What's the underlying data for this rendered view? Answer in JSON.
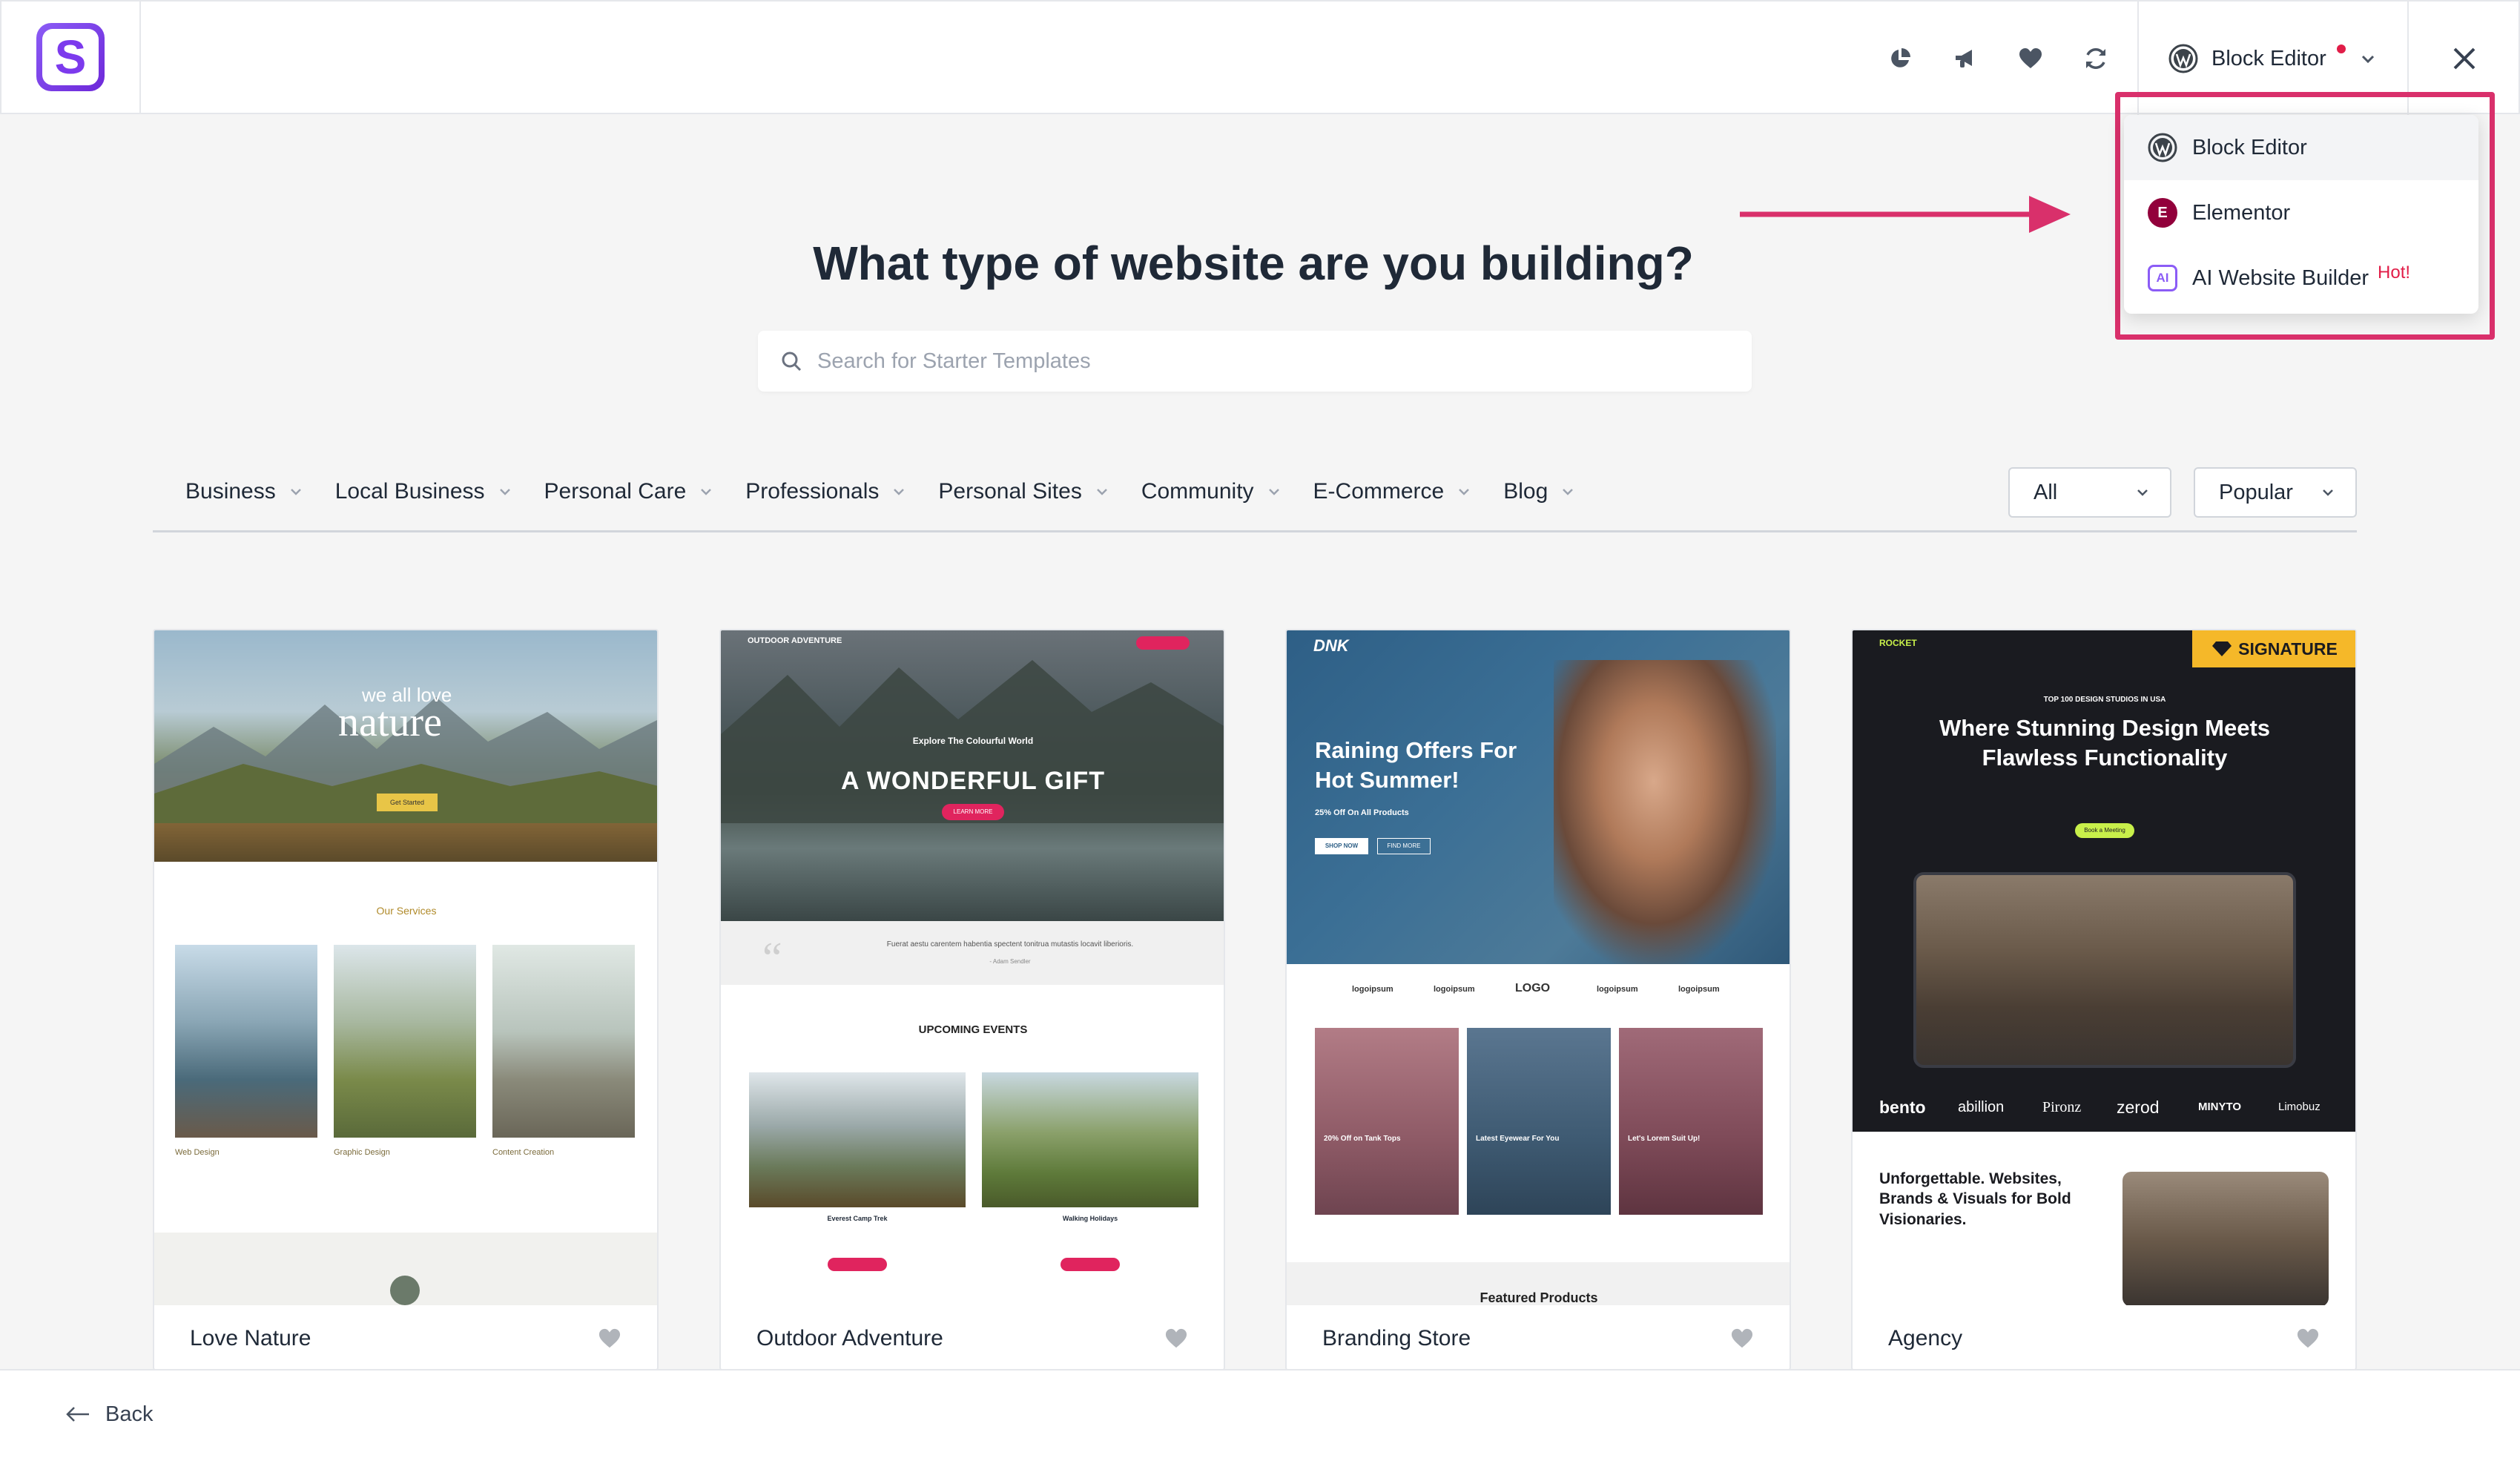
{
  "header": {
    "logo_letter": "S",
    "builder": {
      "label": "Block Editor"
    }
  },
  "dropdown": {
    "items": [
      {
        "label": "Block Editor",
        "icon": "wordpress-icon"
      },
      {
        "label": "Elementor",
        "icon": "elementor-icon",
        "icon_text": "E"
      },
      {
        "label": "AI Website Builder",
        "icon": "ai-icon",
        "icon_text": "AI",
        "badge": "Hot!"
      }
    ]
  },
  "main": {
    "heading": "What type of website are you building?",
    "search": {
      "placeholder": "Search for Starter Templates"
    }
  },
  "categories": [
    {
      "label": "Business"
    },
    {
      "label": "Local Business"
    },
    {
      "label": "Personal Care"
    },
    {
      "label": "Professionals"
    },
    {
      "label": "Personal Sites"
    },
    {
      "label": "Community"
    },
    {
      "label": "E-Commerce"
    },
    {
      "label": "Blog"
    }
  ],
  "filters": {
    "type": "All",
    "sort": "Popular"
  },
  "templates": [
    {
      "name": "Love Nature",
      "preview": {
        "hero_small": "we all love",
        "hero_big": "nature",
        "cta": "Get Started",
        "section": "Our Services",
        "services": [
          "Web Design",
          "Graphic Design",
          "Content Creation"
        ]
      }
    },
    {
      "name": "Outdoor Adventure",
      "preview": {
        "brand": "OUTDOOR ADVENTURE",
        "kicker": "Explore The Colourful World",
        "hero": "A WONDERFUL GIFT",
        "cta": "LEARN MORE",
        "quote": "Fuerat aestu carentem habentia spectent tonitrua mutastis locavit liberioris.",
        "quote_author": "- Adam Sendler",
        "section": "UPCOMING EVENTS",
        "events": [
          "Everest Camp Trek",
          "Walking Holidays"
        ]
      }
    },
    {
      "name": "Branding Store",
      "preview": {
        "brand": "DNK",
        "hero": "Raining Offers For Hot Summer!",
        "sub": "25% Off On All Products",
        "cta1": "SHOP NOW",
        "cta2": "FIND MORE",
        "logos": [
          "logoipsum",
          "logoipsum",
          "LOGO",
          "logoipsum",
          "logoipsum"
        ],
        "tiles": [
          "20% Off on Tank Tops",
          "Latest Eyewear For You",
          "Let's Lorem Suit Up!"
        ],
        "section": "Featured Products"
      }
    },
    {
      "name": "Agency",
      "preview": {
        "badge": "SIGNATURE",
        "brand": "ROCKET",
        "kicker": "TOP 100 DESIGN STUDIOS IN USA",
        "hero": "Where Stunning Design Meets Flawless Functionality",
        "cta": "Book a Meeting",
        "clients": [
          "bento",
          "abillion",
          "Pironz",
          "zerod",
          "MINYTO",
          "Limobuz"
        ],
        "tagline": "Unforgettable. Websites, Brands & Visuals for Bold Visionaries."
      }
    }
  ],
  "footer": {
    "back_label": "Back"
  },
  "colors": {
    "accent": "#d9306b",
    "brand_purple": "#7c3aed",
    "text": "#1f2937"
  }
}
